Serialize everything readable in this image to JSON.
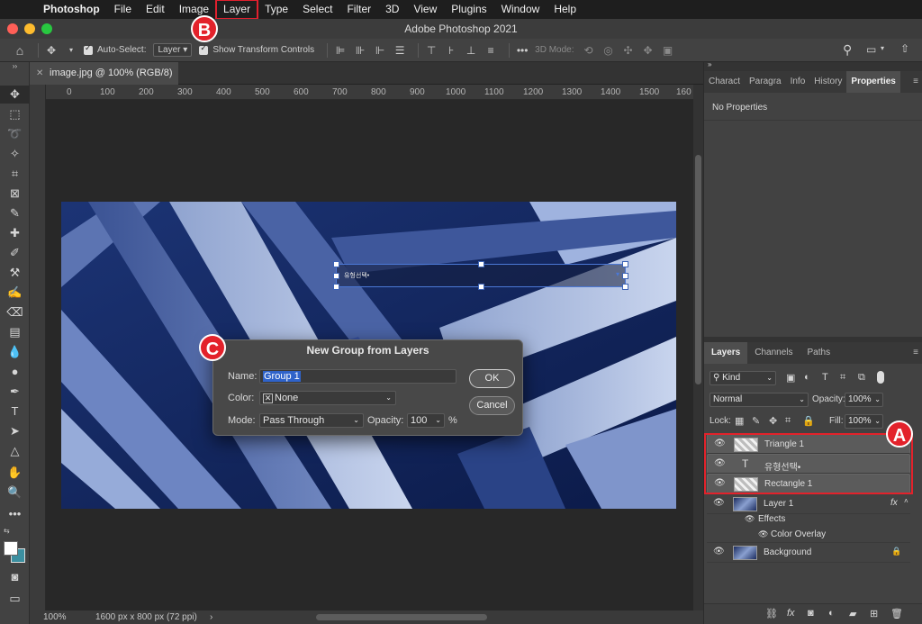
{
  "menubar": {
    "app_name": "Photoshop",
    "items": [
      "File",
      "Edit",
      "Image",
      "Layer",
      "Type",
      "Select",
      "Filter",
      "3D",
      "View",
      "Plugins",
      "Window",
      "Help"
    ],
    "highlighted": "Layer"
  },
  "window": {
    "title": "Adobe Photoshop 2021"
  },
  "options_bar": {
    "auto_select_label": "Auto-Select:",
    "auto_select_value": "Layer",
    "transform_label": "Show Transform Controls",
    "mode_3d_label": "3D Mode:"
  },
  "document": {
    "tab_title": "image.jpg @ 100% (RGB/8) *",
    "ruler_ticks": [
      "0",
      "100",
      "200",
      "300",
      "400",
      "500",
      "600",
      "700",
      "800",
      "900",
      "1000",
      "1100",
      "1200",
      "1300",
      "1400",
      "1500",
      "160"
    ],
    "selection_text": "유형선택•",
    "status_zoom": "100%",
    "status_info": "1600 px x 800 px (72 ppi)"
  },
  "dialog": {
    "title": "New Group from Layers",
    "name_label": "Name:",
    "name_value": "Group 1",
    "color_label": "Color:",
    "color_value": "None",
    "mode_label": "Mode:",
    "mode_value": "Pass Through",
    "opacity_label": "Opacity:",
    "opacity_value": "100",
    "opacity_unit": "%",
    "ok_label": "OK",
    "cancel_label": "Cancel"
  },
  "properties_panel": {
    "tabs": [
      "Charact",
      "Paragra",
      "Info",
      "History",
      "Properties"
    ],
    "active_tab": "Properties",
    "content": "No Properties"
  },
  "layers_panel": {
    "tabs": [
      "Layers",
      "Channels",
      "Paths"
    ],
    "filter_value": "Kind",
    "blend_mode": "Normal",
    "opacity_label": "Opacity:",
    "opacity_value": "100%",
    "lock_label": "Lock:",
    "fill_label": "Fill:",
    "fill_value": "100%",
    "layers": [
      {
        "name": "Triangle 1",
        "selected": true
      },
      {
        "name": "유형선택•",
        "selected": true,
        "type": "text"
      },
      {
        "name": "Rectangle 1",
        "selected": true
      },
      {
        "name": "Layer 1",
        "selected": false,
        "fx": "fx"
      },
      {
        "name": "Effects",
        "selected": false
      },
      {
        "name": "Color Overlay",
        "selected": false
      },
      {
        "name": "Background",
        "selected": false
      }
    ]
  },
  "annotations": {
    "a": "A",
    "b": "B",
    "c": "C"
  },
  "colors": {
    "annotation_red": "#e3222b",
    "accent_blue": "#4b78d6"
  }
}
